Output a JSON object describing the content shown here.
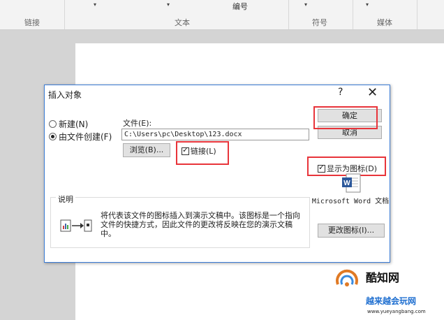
{
  "ribbon": {
    "numbering_title": "编号",
    "groups": [
      "链接",
      "文本",
      "符号",
      "媒体"
    ]
  },
  "dialog": {
    "title": "插入对象",
    "help": "?",
    "close": "✕",
    "options": {
      "new": "新建(N)",
      "from_file": "由文件创建(F)"
    },
    "file_label": "文件(E):",
    "file_path": "C:\\Users\\pc\\Desktop\\123.docx",
    "browse": "浏览(B)...",
    "link": "链接(L)",
    "ok": "确定",
    "cancel": "取消",
    "display_as_icon": "显示为图标(D)",
    "icon_caption": "Microsoft Word 文档",
    "change_icon": "更改图标(I)...",
    "description_label": "说明",
    "description": "将代表该文件的图标插入到演示文稿中。该图标是一个指向文件的快捷方式，因此文件的更改将反映在您的演示文稿中。"
  },
  "watermark": {
    "name": "酷知网",
    "title": "越来越会玩网",
    "url": "www.yueyangbang.com"
  },
  "colors": {
    "highlight": "#e8343a",
    "word_blue": "#2b579a",
    "dialog_border": "#3a7bd5"
  },
  "icons": [
    "word-document-icon",
    "link-object-icon",
    "help-icon",
    "close-icon"
  ]
}
